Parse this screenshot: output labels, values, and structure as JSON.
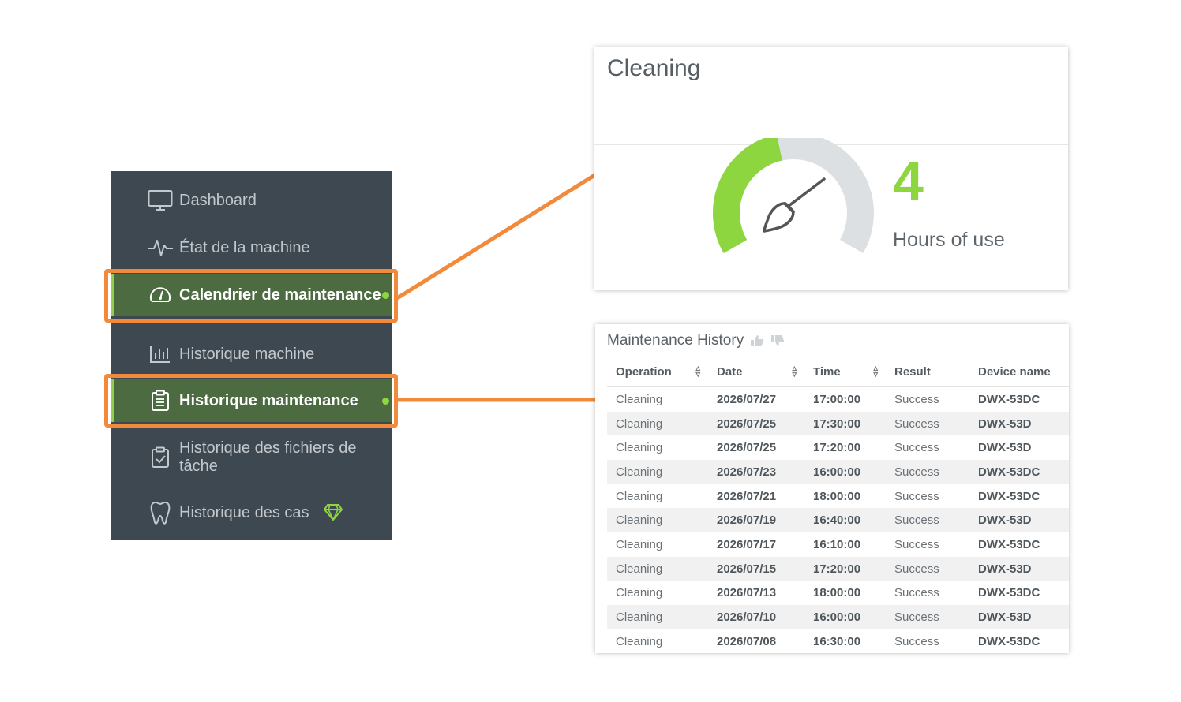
{
  "sidebar": {
    "items": [
      {
        "label": "Dashboard",
        "icon": "monitor-icon"
      },
      {
        "label": "État de la machine",
        "icon": "pulse-icon"
      },
      {
        "label": "Calendrier de maintenance",
        "icon": "gauge-icon"
      },
      {
        "label": "Historique machine",
        "icon": "bar-chart-icon"
      },
      {
        "label": "Historique maintenance",
        "icon": "clipboard-list-icon"
      },
      {
        "label": "Historique des fichiers de tâche",
        "icon": "clipboard-check-icon"
      },
      {
        "label": "Historique des cas",
        "icon": "tooth-icon",
        "badge_icon": "diamond-icon"
      }
    ]
  },
  "cleaning_card": {
    "title": "Cleaning",
    "value": "4",
    "unit_label": "Hours of use",
    "gauge_fraction": 0.45,
    "icon": "broom-icon"
  },
  "history": {
    "title": "Maintenance History",
    "columns": [
      "Operation",
      "Date",
      "Time",
      "Result",
      "Device name"
    ],
    "rows": [
      [
        "Cleaning",
        "2026/07/27",
        "17:00:00",
        "Success",
        "DWX-53DC"
      ],
      [
        "Cleaning",
        "2026/07/25",
        "17:30:00",
        "Success",
        "DWX-53D"
      ],
      [
        "Cleaning",
        "2026/07/25",
        "17:20:00",
        "Success",
        "DWX-53D"
      ],
      [
        "Cleaning",
        "2026/07/23",
        "16:00:00",
        "Success",
        "DWX-53DC"
      ],
      [
        "Cleaning",
        "2026/07/21",
        "18:00:00",
        "Success",
        "DWX-53DC"
      ],
      [
        "Cleaning",
        "2026/07/19",
        "16:40:00",
        "Success",
        "DWX-53D"
      ],
      [
        "Cleaning",
        "2026/07/17",
        "16:10:00",
        "Success",
        "DWX-53DC"
      ],
      [
        "Cleaning",
        "2026/07/15",
        "17:20:00",
        "Success",
        "DWX-53D"
      ],
      [
        "Cleaning",
        "2026/07/13",
        "18:00:00",
        "Success",
        "DWX-53DC"
      ],
      [
        "Cleaning",
        "2026/07/10",
        "16:00:00",
        "Success",
        "DWX-53D"
      ],
      [
        "Cleaning",
        "2026/07/08",
        "16:30:00",
        "Success",
        "DWX-53DC"
      ]
    ]
  },
  "colors": {
    "sidebar_bg": "#3d4850",
    "active_bg": "#4d6b40",
    "accent_green": "#8ed640",
    "highlight_orange": "#f28a3c",
    "gauge_track": "#dde0e2"
  }
}
